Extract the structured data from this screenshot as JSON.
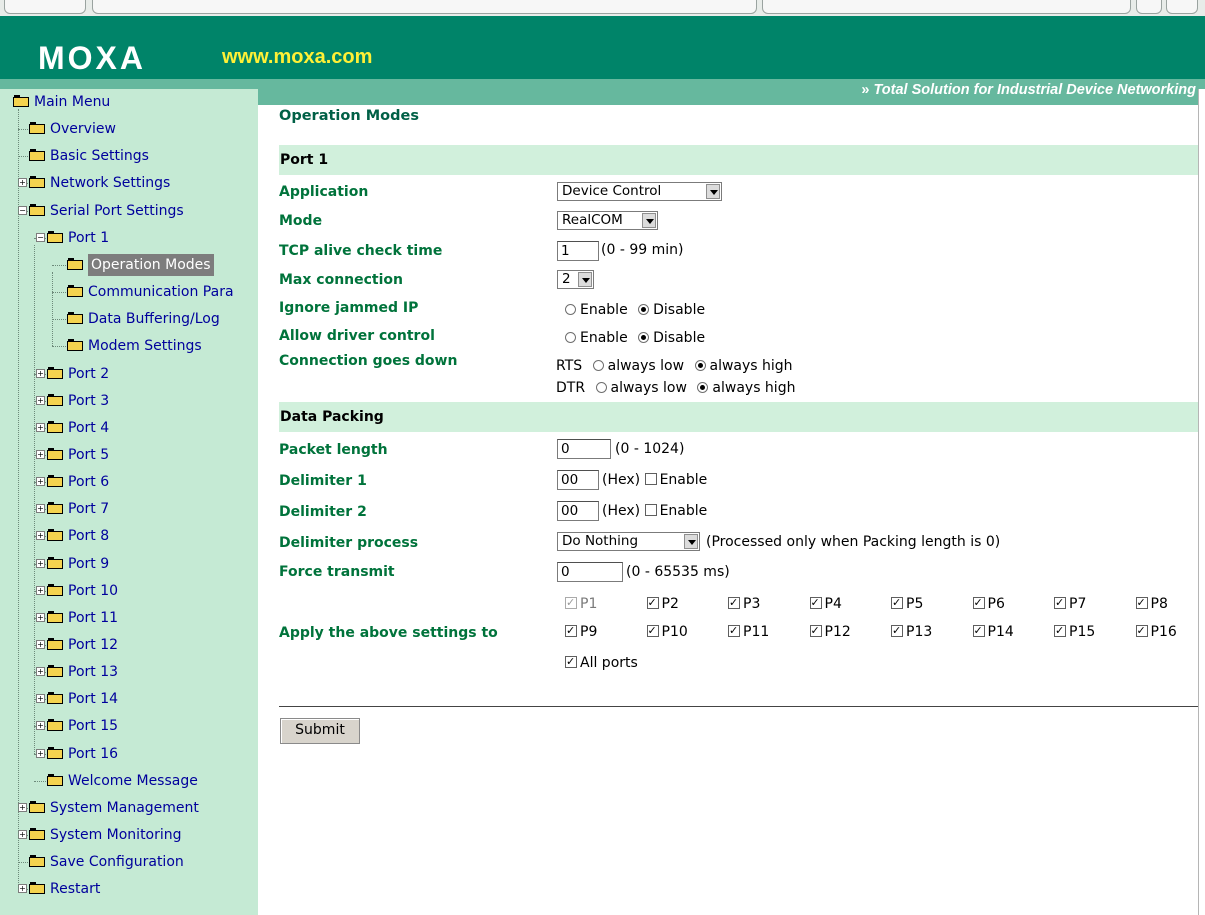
{
  "header": {
    "logo": "MOXA",
    "site": "www.moxa.com",
    "tagline": "Total Solution for Industrial Device Networking",
    "tagline_arrow": "»",
    "brand_color": "#008469"
  },
  "sidebar": {
    "items": [
      {
        "label": "Main Menu",
        "level": 0,
        "expander": "",
        "open": true
      },
      {
        "label": "Overview",
        "level": 1,
        "expander": ""
      },
      {
        "label": "Basic Settings",
        "level": 1,
        "expander": ""
      },
      {
        "label": "Network Settings",
        "level": 1,
        "expander": "+"
      },
      {
        "label": "Serial Port Settings",
        "level": 1,
        "expander": "-",
        "open": true
      },
      {
        "label": "Port 1",
        "level": 2,
        "expander": "-",
        "open": true
      },
      {
        "label": "Operation Modes",
        "level": 3,
        "expander": "",
        "selected": true
      },
      {
        "label": "Communication Para",
        "level": 3,
        "expander": ""
      },
      {
        "label": "Data Buffering/Log",
        "level": 3,
        "expander": ""
      },
      {
        "label": "Modem Settings",
        "level": 3,
        "expander": ""
      },
      {
        "label": "Port 2",
        "level": 2,
        "expander": "+"
      },
      {
        "label": "Port 3",
        "level": 2,
        "expander": "+"
      },
      {
        "label": "Port 4",
        "level": 2,
        "expander": "+"
      },
      {
        "label": "Port 5",
        "level": 2,
        "expander": "+"
      },
      {
        "label": "Port 6",
        "level": 2,
        "expander": "+"
      },
      {
        "label": "Port 7",
        "level": 2,
        "expander": "+"
      },
      {
        "label": "Port 8",
        "level": 2,
        "expander": "+"
      },
      {
        "label": "Port 9",
        "level": 2,
        "expander": "+"
      },
      {
        "label": "Port 10",
        "level": 2,
        "expander": "+"
      },
      {
        "label": "Port 11",
        "level": 2,
        "expander": "+"
      },
      {
        "label": "Port 12",
        "level": 2,
        "expander": "+"
      },
      {
        "label": "Port 13",
        "level": 2,
        "expander": "+"
      },
      {
        "label": "Port 14",
        "level": 2,
        "expander": "+"
      },
      {
        "label": "Port 15",
        "level": 2,
        "expander": "+"
      },
      {
        "label": "Port 16",
        "level": 2,
        "expander": "+"
      },
      {
        "label": "Welcome Message",
        "level": 2,
        "expander": ""
      },
      {
        "label": "System Management",
        "level": 1,
        "expander": "+"
      },
      {
        "label": "System Monitoring",
        "level": 1,
        "expander": "+"
      },
      {
        "label": "Save Configuration",
        "level": 1,
        "expander": ""
      },
      {
        "label": "Restart",
        "level": 1,
        "expander": "+"
      }
    ]
  },
  "main": {
    "title": "Operation Modes",
    "port_section": "Port 1",
    "application": {
      "label": "Application",
      "value": "Device Control"
    },
    "mode": {
      "label": "Mode",
      "value": "RealCOM"
    },
    "tcp_alive": {
      "label": "TCP alive check time",
      "value": "1",
      "hint": "(0 - 99 min)"
    },
    "max_connection": {
      "label": "Max connection",
      "value": "2"
    },
    "ignore_jammed": {
      "label": "Ignore jammed IP",
      "opt1": "Enable",
      "opt2": "Disable",
      "selected": "Disable"
    },
    "driver_control": {
      "label": "Allow driver control",
      "opt1": "Enable",
      "opt2": "Disable",
      "selected": "Disable"
    },
    "connection_down": {
      "label": "Connection goes down",
      "rts": {
        "name": "RTS",
        "opt1": "always low",
        "opt2": "always high",
        "selected": "always high"
      },
      "dtr": {
        "name": "DTR",
        "opt1": "always low",
        "opt2": "always high",
        "selected": "always high"
      }
    },
    "packing_section": "Data Packing",
    "packet_length": {
      "label": "Packet length",
      "value": "0",
      "hint": "(0 - 1024)"
    },
    "delimiter1": {
      "label": "Delimiter 1",
      "value": "00",
      "hex": "(Hex)",
      "enable": "Enable",
      "checked": false
    },
    "delimiter2": {
      "label": "Delimiter 2",
      "value": "00",
      "hex": "(Hex)",
      "enable": "Enable",
      "checked": false
    },
    "delimiter_process": {
      "label": "Delimiter process",
      "value": "Do Nothing",
      "hint": "(Processed only when Packing length is 0)"
    },
    "force_transmit": {
      "label": "Force transmit",
      "value": "0",
      "hint": "(0 - 65535 ms)"
    },
    "apply_to": {
      "label": "Apply the above settings to",
      "ports": [
        "P1",
        "P2",
        "P3",
        "P4",
        "P5",
        "P6",
        "P7",
        "P8",
        "P9",
        "P10",
        "P11",
        "P12",
        "P13",
        "P14",
        "P15",
        "P16"
      ],
      "all_ports": "All ports"
    },
    "submit": "Submit"
  }
}
